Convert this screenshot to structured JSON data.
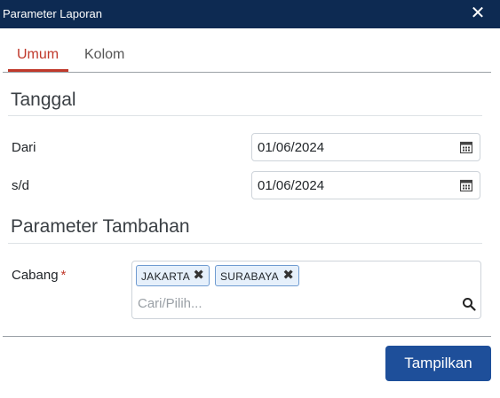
{
  "dialog": {
    "title": "Parameter Laporan",
    "close_icon": "close-icon"
  },
  "tabs": [
    {
      "label": "Umum",
      "active": true
    },
    {
      "label": "Kolom",
      "active": false
    }
  ],
  "sections": {
    "tanggal": {
      "title": "Tanggal",
      "dari_label": "Dari",
      "dari_value": "01/06/2024",
      "sd_label": "s/d",
      "sd_value": "01/06/2024"
    },
    "tambahan": {
      "title": "Parameter Tambahan",
      "cabang_label": "Cabang",
      "required_mark": "*",
      "chips": [
        "JAKARTA",
        "SURABAYA"
      ],
      "chip_remove": "✖",
      "search_placeholder": "Cari/Pilih..."
    }
  },
  "footer": {
    "submit_label": "Tampilkan"
  },
  "colors": {
    "titlebar": "#0d2a52",
    "accent": "#c0392b",
    "button": "#1e4f9a",
    "chip_bg": "#e6f0fb"
  },
  "icons": [
    "close-icon",
    "calendar-icon",
    "search-icon"
  ]
}
